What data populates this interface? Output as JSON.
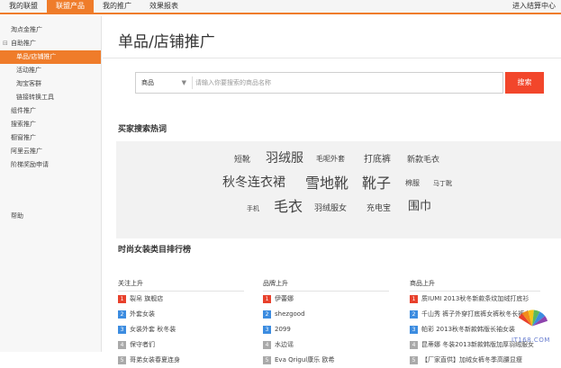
{
  "topbar": {
    "nav": [
      "我的联盟",
      "联盟产品",
      "我的推广",
      "效果报表"
    ],
    "active_index": 1,
    "right_link": "进入结算中心"
  },
  "sidebar": {
    "items": [
      {
        "label": "淘点金推广",
        "type": "item"
      },
      {
        "label": "自助推广",
        "type": "group"
      },
      {
        "label": "单品/店铺推广",
        "type": "sub",
        "active": true
      },
      {
        "label": "活动推广",
        "type": "sub"
      },
      {
        "label": "淘宝客群",
        "type": "sub"
      },
      {
        "label": "链接转换工具",
        "type": "sub"
      },
      {
        "label": "组件推广",
        "type": "item"
      },
      {
        "label": "搜索推广",
        "type": "item"
      },
      {
        "label": "橱窗推广",
        "type": "item"
      },
      {
        "label": "阿里云推广",
        "type": "item"
      },
      {
        "label": "阶梯奖励申请",
        "type": "item"
      }
    ],
    "help": "帮助"
  },
  "main": {
    "title": "单品/店铺推广",
    "search": {
      "category": "商品",
      "placeholder": "请输入你要搜索的商品名称",
      "button": "搜索"
    },
    "hot_title": "买家搜索热词",
    "hot_words": [
      {
        "text": "短靴",
        "size": 9
      },
      {
        "text": "羽绒服",
        "size": 14
      },
      {
        "text": "毛呢外套",
        "size": 8
      },
      {
        "text": "打底裤",
        "size": 10
      },
      {
        "text": "新款毛衣",
        "size": 9
      },
      {
        "text": "秋冬连衣裙",
        "size": 14
      },
      {
        "text": "雪地靴",
        "size": 16
      },
      {
        "text": "靴子",
        "size": 16
      },
      {
        "text": "棉服",
        "size": 8
      },
      {
        "text": "马丁靴",
        "size": 7
      },
      {
        "text": "手机",
        "size": 7
      },
      {
        "text": "毛衣",
        "size": 16
      },
      {
        "text": "羽绒服女",
        "size": 9
      },
      {
        "text": "充电宝",
        "size": 9
      },
      {
        "text": "围巾",
        "size": 13
      }
    ],
    "rank_title": "时尚女装类目排行榜",
    "rank_columns": [
      {
        "head": "关注上升",
        "rows": [
          "裂帛 旗舰店",
          "外套女装",
          "女装外套 秋冬装",
          "保守者们",
          "哥弟女装春夏连身"
        ]
      },
      {
        "head": "品牌上升",
        "rows": [
          "伊蕾娜",
          "shezgood",
          "2099",
          "水边谣",
          "Eva Qrigul康乐 欧希"
        ]
      },
      {
        "head": "商品上升",
        "rows": [
          "质IUMI 2013秋冬新款条纹加绒打底衫",
          "千山秀 裤子外穿打底裤女裤秋冬长裤女",
          "帕彩 2013秋冬新款韩版长袖女装",
          "昆蒂娜 冬装2013新款韩版加厚羽绒服女",
          "【厂家直供】加绒女裤冬季高腰显瘦"
        ]
      }
    ]
  },
  "watermark": {
    "text": "IT168.COM"
  },
  "colors": {
    "accent": "#ef7c2a",
    "search_button": "#f2462b",
    "rank_top": "#e8412c",
    "rank_blue": "#3c8ce0",
    "rank_gray": "#aaaaaa"
  }
}
